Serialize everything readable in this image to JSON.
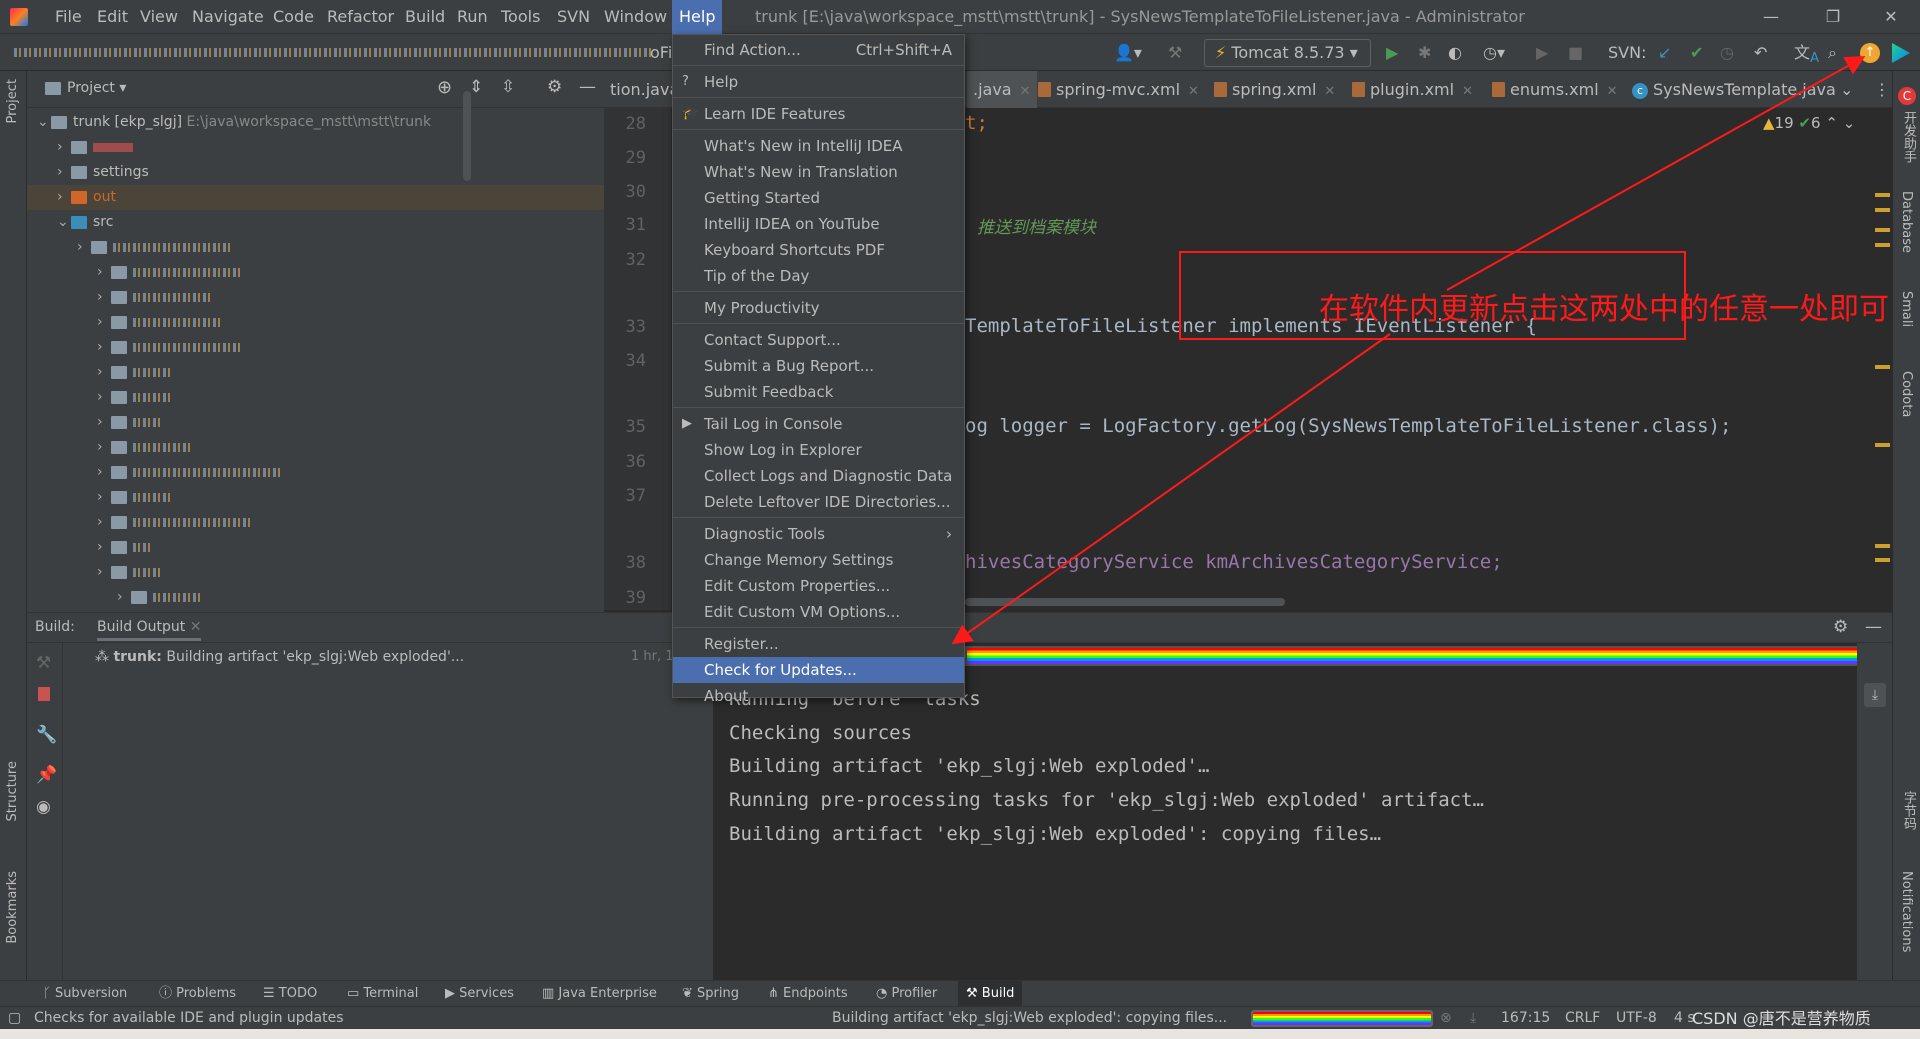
{
  "menubar": {
    "items": [
      "File",
      "Edit",
      "View",
      "Navigate",
      "Code",
      "Refactor",
      "Build",
      "Run",
      "Tools",
      "SVN",
      "Window",
      "Help"
    ],
    "active": "Help"
  },
  "window": {
    "title": "trunk [E:\\java\\workspace_mstt\\mstt\\trunk] - SysNewsTemplateToFileListener.java - Administrator",
    "minimize": "—",
    "restore": "❐",
    "close": "✕"
  },
  "toolbar": {
    "breadcrumb_tail": "oFile",
    "run_config": "Tomcat 8.5.73",
    "svn_label": "SVN:"
  },
  "project": {
    "title": "Project",
    "root_label": "trunk [ekp_slgj]",
    "root_path": "E:\\java\\workspace_mstt\\mstt\\trunk",
    "items": [
      "",
      "settings",
      "out",
      "src"
    ]
  },
  "tabs": [
    {
      "label": "tion.java"
    },
    {
      "label": ".java"
    },
    {
      "label": "spring-mvc.xml"
    },
    {
      "label": "spring.xml"
    },
    {
      "label": "plugin.xml"
    },
    {
      "label": "enums.xml"
    },
    {
      "label": "SysNewsTemplate.java"
    }
  ],
  "editor": {
    "line_numbers": [
      "28",
      "29",
      "30",
      "31",
      "32",
      "33",
      "34",
      "35",
      "36",
      "37",
      "38",
      "39"
    ],
    "code": {
      "l28": "t;",
      "comment": "推送到档案模块",
      "l33": "TemplateToFileListener implements IEventListener {",
      "l35": "og logger = LogFactory.getLog(SysNewsTemplateToFileListener.class);",
      "l38": "hivesCategoryService kmArchivesCategoryService;"
    },
    "warnings": "19",
    "checks": "6"
  },
  "help_menu": {
    "groups": [
      [
        {
          "label": "Find Action...",
          "shortcut": "Ctrl+Shift+A"
        }
      ],
      [
        {
          "label": "Help",
          "icon": "question-icon"
        }
      ],
      [
        {
          "label": "Learn IDE Features",
          "icon": "graduation-cap-icon"
        }
      ],
      [
        {
          "label": "What's New in IntelliJ IDEA"
        },
        {
          "label": "What's New in Translation"
        },
        {
          "label": "Getting Started"
        },
        {
          "label": "IntelliJ IDEA on YouTube"
        },
        {
          "label": "Keyboard Shortcuts PDF"
        },
        {
          "label": "Tip of the Day"
        }
      ],
      [
        {
          "label": "My Productivity"
        }
      ],
      [
        {
          "label": "Contact Support..."
        },
        {
          "label": "Submit a Bug Report..."
        },
        {
          "label": "Submit Feedback"
        }
      ],
      [
        {
          "label": "Tail Log in Console",
          "icon": "play-icon"
        },
        {
          "label": "Show Log in Explorer"
        },
        {
          "label": "Collect Logs and Diagnostic Data"
        },
        {
          "label": "Delete Leftover IDE Directories..."
        }
      ],
      [
        {
          "label": "Diagnostic Tools",
          "submenu": true
        },
        {
          "label": "Change Memory Settings"
        },
        {
          "label": "Edit Custom Properties..."
        },
        {
          "label": "Edit Custom VM Options..."
        }
      ],
      [
        {
          "label": "Register..."
        },
        {
          "label": "Check for Updates...",
          "highlighted": true
        },
        {
          "label": "About"
        }
      ]
    ]
  },
  "annotation": {
    "text": "在软件内更新点击这两处中的任意一处即可",
    "color": "#ff1a1a"
  },
  "build": {
    "label": "Build:",
    "tab": "Build Output",
    "tree_item_bold": "trunk:",
    "tree_item": "Building artifact 'ekp_slgj:Web exploded'...",
    "tree_time": "1 hr, 1",
    "console": [
      "Running 'before' tasks",
      "Checking sources",
      "Building artifact 'ekp_slgj:Web exploded'…",
      "Running pre-processing tasks for 'ekp_slgj:Web exploded' artifact…",
      "Building artifact 'ekp_slgj:Web exploded': copying files…"
    ]
  },
  "tool_windows": [
    "Subversion",
    "Problems",
    "TODO",
    "Terminal",
    "Services",
    "Java Enterprise",
    "Spring",
    "Endpoints",
    "Profiler",
    "Build"
  ],
  "side_labels": {
    "left": [
      "Project",
      "Structure",
      "Bookmarks"
    ],
    "right": [
      "开发助手",
      "Database",
      "Smali",
      "Codota",
      "字节码",
      "Notifications"
    ]
  },
  "status": {
    "message": "Checks for available IDE and plugin updates",
    "progress_text": "Building artifact 'ekp_slgj:Web exploded': copying files...",
    "position": "167:15",
    "line_sep": "CRLF",
    "encoding": "UTF-8",
    "indent": "4 s",
    "watermark": "CSDN @唐不是营养物质"
  },
  "colors": {
    "accent": "#4b6eaf",
    "annotation": "#ff1a1a",
    "warning": "#c9a12c"
  }
}
